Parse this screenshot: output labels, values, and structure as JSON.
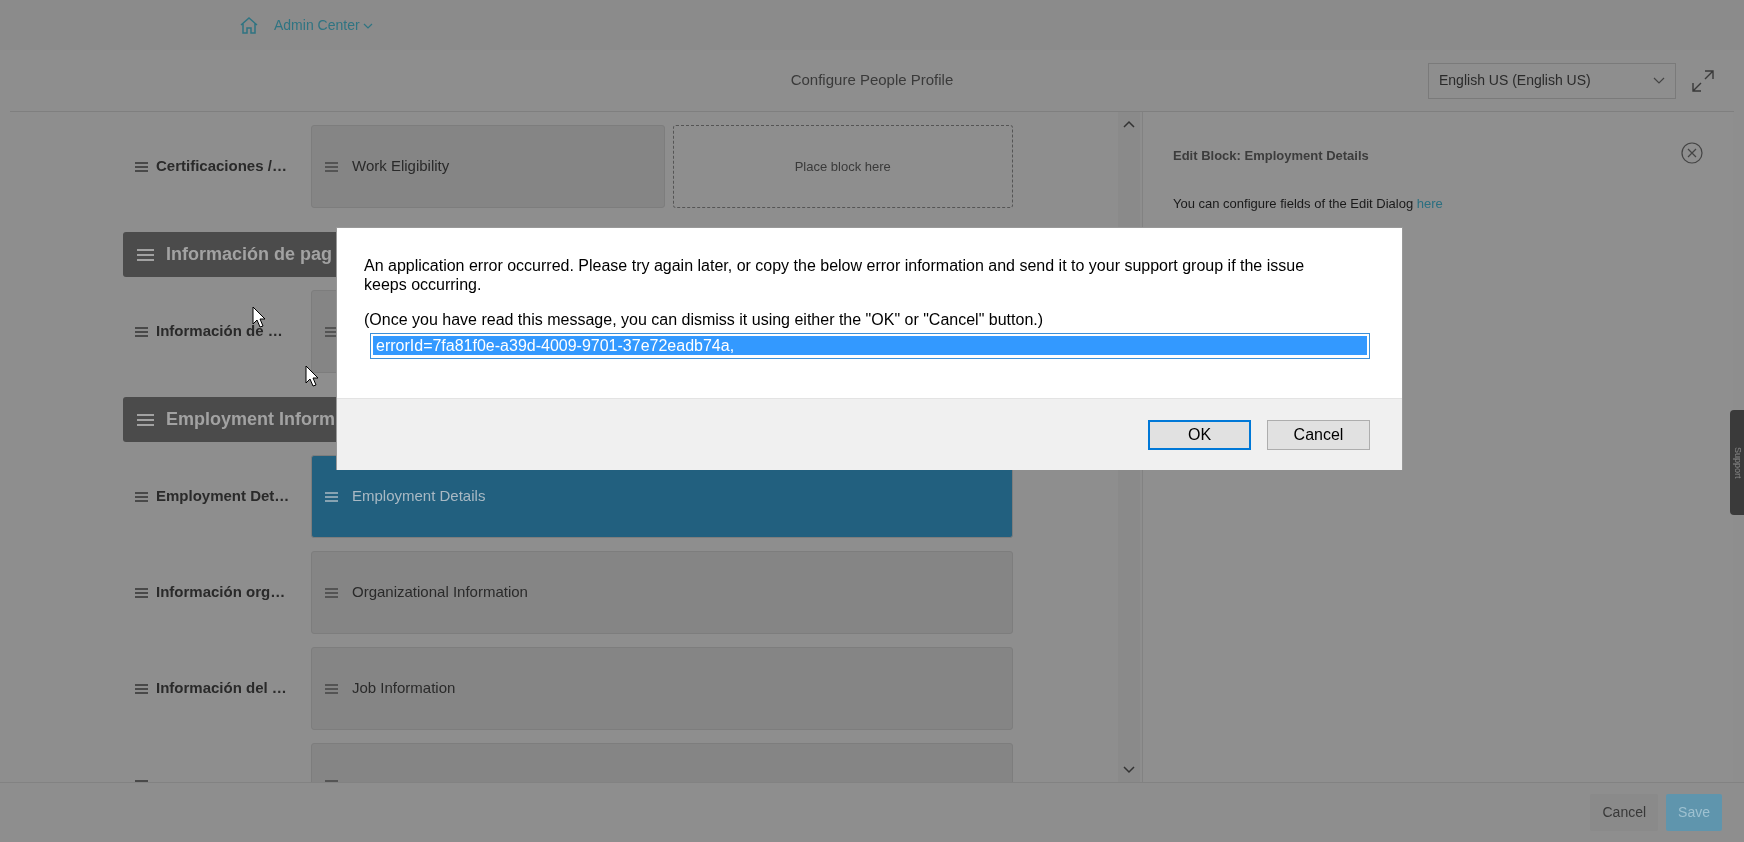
{
  "header": {
    "breadcrumb": "Admin Center"
  },
  "page_title": "Configure People Profile",
  "language_select": {
    "value": "English US (English US)"
  },
  "canvas": {
    "items": [
      {
        "kind": "row",
        "label": "Certificaciones /…",
        "blocks": [
          {
            "kind": "block",
            "text": "Work Eligibility",
            "selected": false
          },
          {
            "kind": "drop",
            "text": "Place block here"
          }
        ]
      },
      {
        "kind": "section",
        "label": "Información de pag"
      },
      {
        "kind": "row",
        "label": "Información de …",
        "blocks": [
          {
            "kind": "block",
            "selected": false
          }
        ]
      },
      {
        "kind": "section",
        "label": "Employment Inform"
      },
      {
        "kind": "row",
        "label": "Employment Det…",
        "blocks": [
          {
            "kind": "block",
            "text": "Employment Details",
            "selected": true
          }
        ]
      },
      {
        "kind": "row",
        "label": "Información org…",
        "blocks": [
          {
            "kind": "block",
            "text": "Organizational Information",
            "selected": false
          }
        ]
      },
      {
        "kind": "row",
        "label": "Información del …",
        "blocks": [
          {
            "kind": "block",
            "text": "Job Information",
            "selected": false
          }
        ]
      },
      {
        "kind": "row",
        "blocks": [
          {
            "kind": "block",
            "selected": false
          }
        ]
      }
    ]
  },
  "edit_panel": {
    "title": "Edit Block: Employment Details",
    "hint": "You can configure fields of the Edit Dialog",
    "hint_link": "here"
  },
  "footer": {
    "buttons": [
      {
        "kind": "secondary",
        "label": "Cancel",
        "disabled": true
      },
      {
        "kind": "primary",
        "label": "Save",
        "disabled": true
      }
    ]
  },
  "support_tab": "Support",
  "dialog": {
    "message": "An application error occurred. Please try again later, or copy the below error information and send it to your support group if the issue keeps occurring.",
    "note": "(Once you have read this message, you can dismiss it using either the \"OK\" or \"Cancel\" button.)",
    "error_field": {
      "value": "errorId=7fa81f0e-a39d-4009-9701-37e72eadb74a,",
      "selected": true
    },
    "buttons": [
      {
        "label": "OK",
        "focused": true
      },
      {
        "label": "Cancel",
        "focused": false
      }
    ]
  }
}
